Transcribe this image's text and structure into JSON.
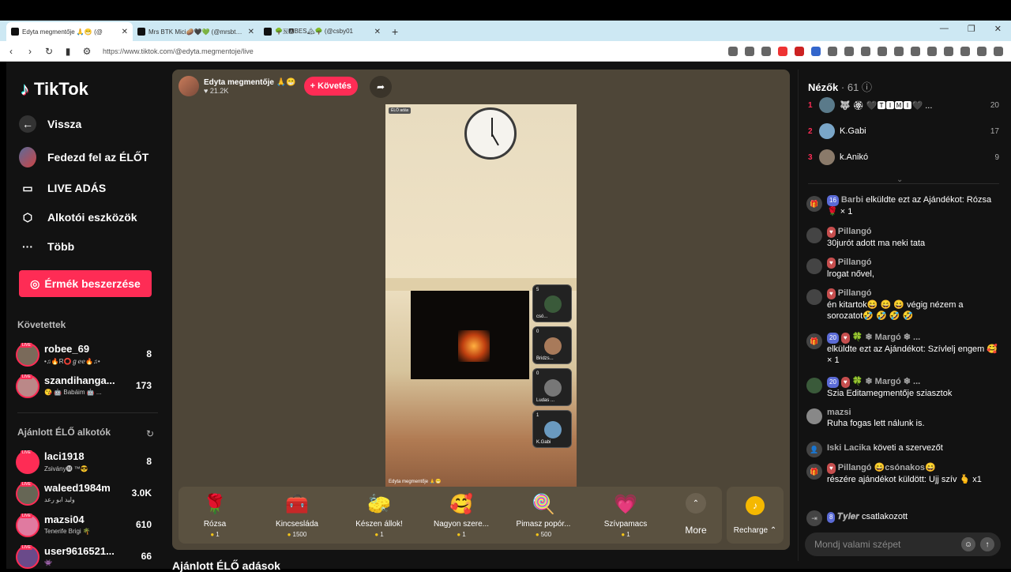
{
  "browser": {
    "tabs": [
      {
        "title": "Edyta megmentője 🙏😁 (@"
      },
      {
        "title": "Mrs BTK Mici🥔🖤💚 (@mrsbtk) É"
      },
      {
        "title": "🌳🇳🅰BES🏔🌳 (@csby01"
      }
    ],
    "url": "https://www.tiktok.com/@edyta.megmentoje/live"
  },
  "sidebar": {
    "logo": "TikTok",
    "back": "Vissza",
    "explore": "Fedezd fel az ÉLŐT",
    "live": "LIVE ADÁS",
    "creator_tools": "Alkotói eszközök",
    "more": "Több",
    "coins_button": "Érmék beszerzése",
    "following_title": "Követettek",
    "following": [
      {
        "name": "robee_69",
        "sub": "•♫🔥R⭕ℊℯℯ🔥♫•",
        "count": "8"
      },
      {
        "name": "szandihanga...",
        "sub": "😘 🤖 Babáim 🤖 ...",
        "count": "173"
      }
    ],
    "recommended_title": "Ajánlott ÉLŐ alkotók",
    "recommended": [
      {
        "name": "laci1918",
        "sub": "Zsivány🅜 ™😎",
        "count": "8"
      },
      {
        "name": "waleed1984m",
        "sub": "وليد ابو رعد",
        "count": "3.0K"
      },
      {
        "name": "mazsi04",
        "sub": "Tenerife Brigi 🌴",
        "count": "610"
      },
      {
        "name": "user9616521...",
        "sub": "👾",
        "count": "66"
      }
    ]
  },
  "stream": {
    "host_name": "Edyta megmentője 🙏😁",
    "likes": "21.2K",
    "follow_button": "+ Követés",
    "live_badge": "ÉLŐ adás",
    "caption": "Edyta megmentője 🙏😁",
    "guests": [
      {
        "num": "5",
        "name": "csó..."
      },
      {
        "num": "0",
        "name": "Bridzs..."
      },
      {
        "num": "0",
        "name": "Ludas ..."
      },
      {
        "num": "1",
        "name": "K.Gabi"
      }
    ],
    "gifts": [
      {
        "icon": "🌹",
        "name": "Rózsa",
        "price": "1"
      },
      {
        "icon": "🧰",
        "name": "Kincsesláda",
        "price": "1500"
      },
      {
        "icon": "🧽",
        "name": "Készen állok!",
        "price": "1"
      },
      {
        "icon": "🥰",
        "name": "Nagyon szere...",
        "price": "1"
      },
      {
        "icon": "🍭",
        "name": "Pimasz popór...",
        "price": "500"
      },
      {
        "icon": "💗",
        "name": "Szívpamacs",
        "price": "1"
      }
    ],
    "more_label": "More",
    "recharge_label": "Recharge ⌃",
    "recommended_section": "Ajánlott ÉLŐ adások"
  },
  "viewers": {
    "title": "Nézők",
    "count": "· 61",
    "top": [
      {
        "rank": "1",
        "name": "🐺 🏵 🖤🆃🅸🅼🅸🖤 ...",
        "score": "20"
      },
      {
        "rank": "2",
        "name": "K.Gabi",
        "score": "17"
      },
      {
        "rank": "3",
        "name": "k.Anikó",
        "score": "9"
      }
    ]
  },
  "chat": [
    {
      "level": "16",
      "user": "Barbi",
      "text": "elküldte ezt az Ajándékot: Rózsa 🌹 × 1"
    },
    {
      "user": "Pillangó",
      "text": "30jurót adott ma neki tata"
    },
    {
      "user": "Pillangó",
      "text": "lrogat nővel,"
    },
    {
      "user": "Pillangó",
      "text": "én kitartok😄 😄 😄 végig nézem a sorozatot🤣 🤣 🤣 🤣"
    },
    {
      "level": "20",
      "user": "🍀 ❄ Margó ❄ ...",
      "text": "elküldte ezt az Ajándékot: Szívlelj engem 🥰 × 1"
    },
    {
      "level": "20",
      "user": "🍀 ❄ Margó ❄ ...",
      "text": "Szia Editamegmentője sziasztok"
    },
    {
      "user": "mazsi",
      "text": "Ruha fogas lett nálunk is."
    },
    {
      "user": "Iski Lacika",
      "text": "követi a szervezőt"
    },
    {
      "user": "Pillangó 😄csónakos😄",
      "text": "részére ajándékot küldött: Ujj szív 🫰 x1"
    },
    {
      "level": "8",
      "user": "𝑻𝒚𝒍𝒆𝒓",
      "text": "csatlakozott"
    }
  ],
  "chat_input_placeholder": "Mondj valami szépet"
}
